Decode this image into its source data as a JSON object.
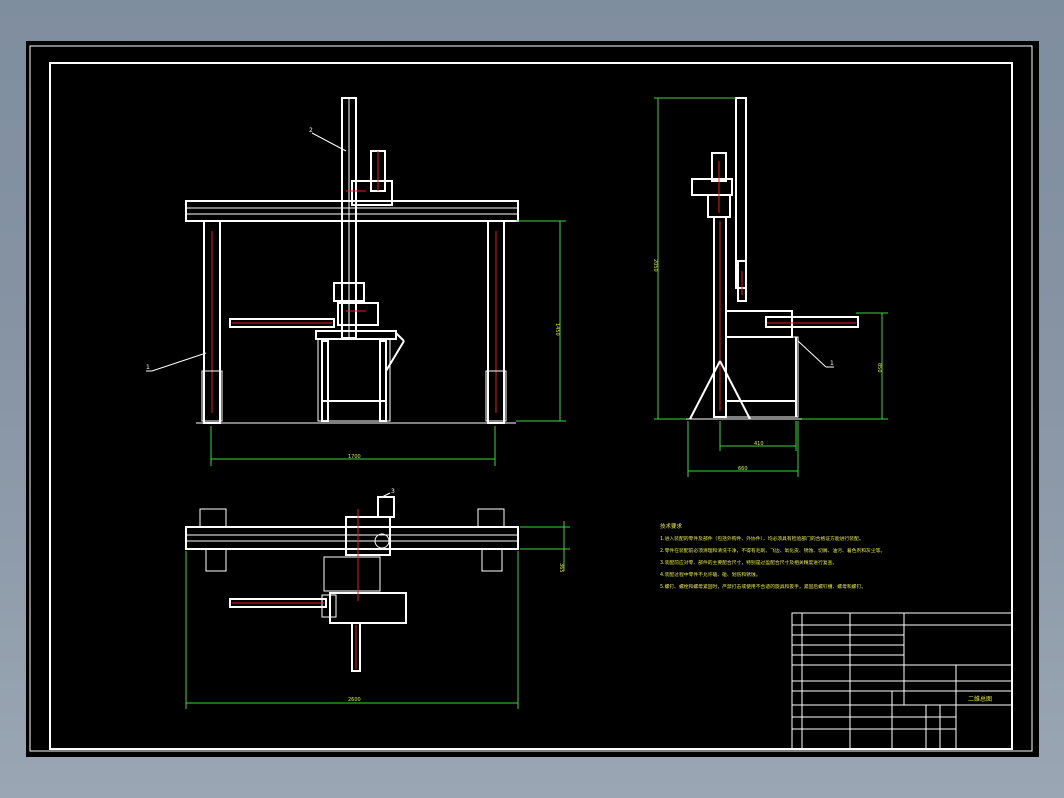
{
  "drawing": {
    "tech_title": "技术要求",
    "tech_requirements": [
      "1.进入装配的零件及部件（包括外购件、外协件），均必须具有检验部门的合格证方能进行装配。",
      "2.零件在装配前必须清理和清洗干净，不得有毛刺、飞边、氧化皮、锈蚀、切屑、油污、着色剂和灰尘等。",
      "3.装配前应对零、部件的主要配合尺寸，特别是过盈配合尺寸及相关精度进行复查。",
      "4.装配过程中零件不允许磕、碰、划伤和锈蚀。",
      "5.螺钉、螺栓和螺母紧固时，严禁打击或使用不合适的旋具和扳手，紧固后螺钉槽、螺母和螺钉。"
    ],
    "title_block_name": "二维总图",
    "balloons": [
      "1",
      "2",
      "1",
      "3"
    ],
    "dimensions": {
      "front_width": "1700",
      "front_height": "1450",
      "side_height": "2050",
      "side_table_height": "850",
      "side_width_1": "410",
      "side_width_2": "660",
      "top_width": "2600",
      "top_depth": "365"
    },
    "colors": {
      "background": "#000000",
      "frame": "#ffffff",
      "dimension": "#3fd43f",
      "centerline": "#e02020",
      "text": "#e8e84a"
    }
  }
}
